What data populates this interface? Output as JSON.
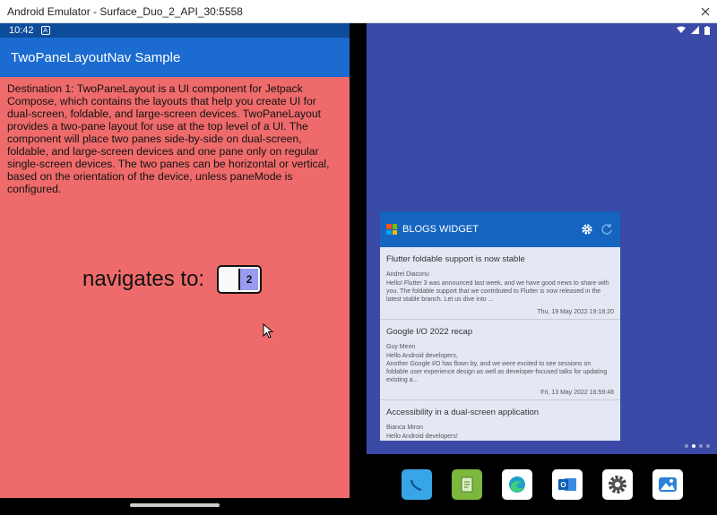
{
  "window": {
    "title": "Android Emulator - Surface_Duo_2_API_30:5558"
  },
  "left_screen": {
    "time": "10:42",
    "app_title": "TwoPaneLayoutNav Sample",
    "description": "Destination 1: TwoPaneLayout is a UI component for Jetpack Compose, which contains the layouts that help you create UI for dual-screen, foldable, and large-screen devices. TwoPaneLayout provides a two-pane layout for use at the top level of a UI. The component will place two panes side-by-side on dual-screen, foldable, and large-screen devices and one pane only on regular single-screen devices. The two panes can be horizontal or vertical, based on the orientation of the device, unless paneMode is configured.",
    "navigates_label": "navigates to:",
    "pane_number": "2",
    "background_color": "#ef6b6b",
    "appbar_color": "#1b6bd0"
  },
  "right_screen": {
    "widget": {
      "title": "BLOGS WIDGET",
      "posts": [
        {
          "title": "Flutter foldable support is now stable",
          "author": "Andrei Diaconu",
          "body": "Hello! Flutter 3 was announced last week, and we have good news to share with you. The foldable support that we contributed to Flutter is now released in the latest stable branch. Let us dive into ...",
          "date": "Thu, 19 May 2022 19:18:20"
        },
        {
          "title": "Google I/O 2022 recap",
          "author": "Guy Merin",
          "body": "Hello Android developers,\nAnother Google I/O has flown by, and we were excited to see sessions on foldable user experience design as well as developer-focused talks for updating existing a...",
          "date": "Fri, 13 May 2022 16:59:48"
        },
        {
          "title": "Accessibility in a dual-screen application",
          "author": "Bianca Miron",
          "body": "Hello Android developers!",
          "date": ""
        }
      ]
    },
    "dock_apps": [
      "phone-icon",
      "files-icon",
      "edge-icon",
      "outlook-icon",
      "settings-icon",
      "gallery-icon"
    ],
    "background_color": "#3a4aa6"
  }
}
